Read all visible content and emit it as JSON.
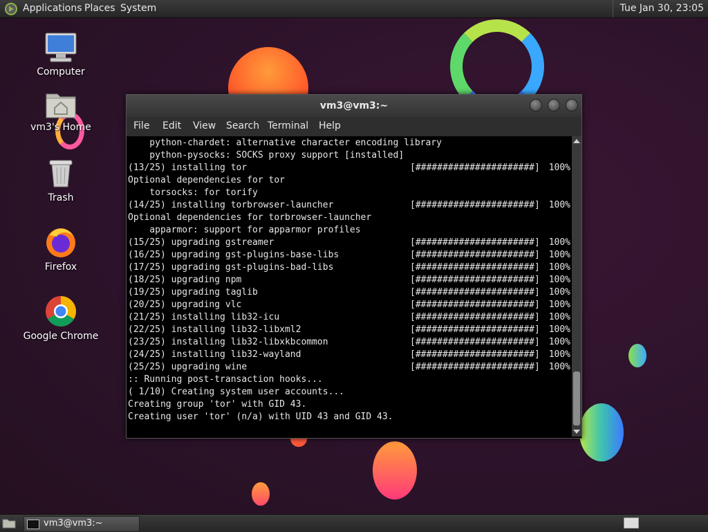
{
  "top_panel": {
    "menus": [
      "Applications",
      "Places",
      "System"
    ],
    "clock": "Tue Jan 30, 23:05"
  },
  "desktop_icons": [
    {
      "label": "Computer",
      "icon": "computer-icon"
    },
    {
      "label": "vm3's Home",
      "icon": "home-folder-icon"
    },
    {
      "label": "Trash",
      "icon": "trash-icon"
    },
    {
      "label": "Firefox",
      "icon": "firefox-icon"
    },
    {
      "label": "Google Chrome",
      "icon": "chrome-icon"
    }
  ],
  "terminal": {
    "title": "vm3@vm3:~",
    "menu": [
      "File",
      "Edit",
      "View",
      "Search",
      "Terminal",
      "Help"
    ],
    "lines": [
      {
        "text": "    python-chardet: alternative character encoding library"
      },
      {
        "text": "    python-pysocks: SOCKS proxy support [installed]"
      },
      {
        "pkg": "(13/25) installing tor",
        "bar": "[######################]",
        "pct": "100%"
      },
      {
        "text": "Optional dependencies for tor"
      },
      {
        "text": "    torsocks: for torify"
      },
      {
        "pkg": "(14/25) installing torbrowser-launcher",
        "bar": "[######################]",
        "pct": "100%"
      },
      {
        "text": "Optional dependencies for torbrowser-launcher"
      },
      {
        "text": "    apparmor: support for apparmor profiles"
      },
      {
        "pkg": "(15/25) upgrading gstreamer",
        "bar": "[######################]",
        "pct": "100%"
      },
      {
        "pkg": "(16/25) upgrading gst-plugins-base-libs",
        "bar": "[######################]",
        "pct": "100%"
      },
      {
        "pkg": "(17/25) upgrading gst-plugins-bad-libs",
        "bar": "[######################]",
        "pct": "100%"
      },
      {
        "pkg": "(18/25) upgrading npm",
        "bar": "[######################]",
        "pct": "100%"
      },
      {
        "pkg": "(19/25) upgrading taglib",
        "bar": "[######################]",
        "pct": "100%"
      },
      {
        "pkg": "(20/25) upgrading vlc",
        "bar": "[######################]",
        "pct": "100%"
      },
      {
        "pkg": "(21/25) installing lib32-icu",
        "bar": "[######################]",
        "pct": "100%"
      },
      {
        "pkg": "(22/25) installing lib32-libxml2",
        "bar": "[######################]",
        "pct": "100%"
      },
      {
        "pkg": "(23/25) installing lib32-libxkbcommon",
        "bar": "[######################]",
        "pct": "100%"
      },
      {
        "pkg": "(24/25) installing lib32-wayland",
        "bar": "[######################]",
        "pct": "100%"
      },
      {
        "pkg": "(25/25) upgrading wine",
        "bar": "[######################]",
        "pct": "100%"
      },
      {
        "text": ":: Running post-transaction hooks..."
      },
      {
        "text": "( 1/10) Creating system user accounts..."
      },
      {
        "text": "Creating group 'tor' with GID 43."
      },
      {
        "text": "Creating user 'tor' (n/a) with UID 43 and GID 43."
      }
    ]
  },
  "taskbar": {
    "window_button": "vm3@vm3:~"
  },
  "colors": {
    "desktop_bg": "#2b1229",
    "terminal_bg": "#000000",
    "terminal_fg": "#e6e6e6"
  }
}
